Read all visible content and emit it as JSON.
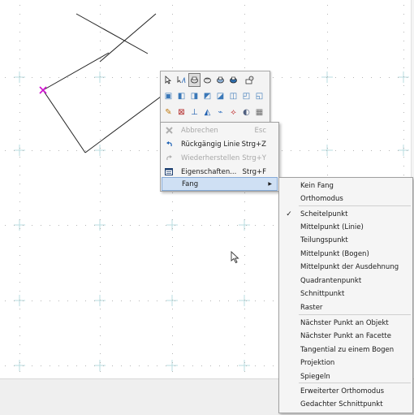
{
  "palette": {
    "row1": [
      {
        "icon": "pointer-icon",
        "active": false
      },
      {
        "icon": "node-pointer-icon",
        "active": false
      },
      {
        "icon": "snap-object-icon",
        "active": true
      },
      {
        "icon": "snap-object-2-icon",
        "active": false
      },
      {
        "icon": "snap-object-3-icon",
        "active": false
      },
      {
        "icon": "snap-object-4-icon",
        "active": false
      },
      {
        "icon": "snap-settings-icon",
        "active": false
      }
    ],
    "row2": [
      {
        "icon": "cube-view-1-icon"
      },
      {
        "icon": "cube-view-2-icon"
      },
      {
        "icon": "cube-view-3-icon"
      },
      {
        "icon": "cube-view-4-icon"
      },
      {
        "icon": "cube-view-5-icon"
      },
      {
        "icon": "cube-view-6-icon"
      },
      {
        "icon": "cube-view-7-icon"
      },
      {
        "icon": "cube-view-8-icon"
      }
    ],
    "row3": [
      {
        "icon": "tool-1-icon"
      },
      {
        "icon": "tool-2-icon"
      },
      {
        "icon": "tool-3-icon"
      },
      {
        "icon": "tool-4-icon"
      },
      {
        "icon": "tool-5-icon"
      },
      {
        "icon": "tool-6-icon"
      },
      {
        "icon": "tool-7-icon"
      },
      {
        "icon": "tool-8-icon"
      }
    ]
  },
  "menu": {
    "items": [
      {
        "label": "Abbrechen",
        "shortcut": "Esc",
        "icon": "cancel-icon",
        "disabled": true
      },
      {
        "label": "Rückgängig Linie",
        "shortcut": "Strg+Z",
        "icon": "undo-icon",
        "disabled": false
      },
      {
        "label": "Wiederherstellen",
        "shortcut": "Strg+Y",
        "icon": "redo-icon",
        "disabled": true
      },
      {
        "label": "Eigenschaften...",
        "shortcut": "Strg+F",
        "icon": "properties-icon",
        "disabled": false
      },
      {
        "label": "Fang",
        "shortcut": "",
        "icon": "",
        "disabled": false,
        "highlight": true,
        "submenu": true
      }
    ]
  },
  "submenu": {
    "items": [
      {
        "label": "Kein Fang",
        "checked": false
      },
      {
        "label": "Orthomodus",
        "checked": false
      },
      {
        "label": "Scheitelpunkt",
        "checked": true
      },
      {
        "label": "Mittelpunkt (Linie)",
        "checked": false
      },
      {
        "label": "Teilungspunkt",
        "checked": false
      },
      {
        "label": "Mittelpunkt (Bogen)",
        "checked": false
      },
      {
        "label": "Mittelpunkt der Ausdehnung",
        "checked": false
      },
      {
        "label": "Quadrantenpunkt",
        "checked": false
      },
      {
        "label": "Schnittpunkt",
        "checked": false
      },
      {
        "label": "Raster",
        "checked": false
      },
      {
        "label": "Nächster Punkt an Objekt",
        "checked": false
      },
      {
        "label": "Nächster Punkt an Facette",
        "checked": false
      },
      {
        "label": "Tangential zu einem Bogen",
        "checked": false
      },
      {
        "label": "Projektion",
        "checked": false
      },
      {
        "label": "Spiegeln",
        "checked": false
      },
      {
        "label": "Erweiterter Orthomodus",
        "checked": false
      },
      {
        "label": "Gedachter Schnittpunkt",
        "checked": false
      }
    ]
  },
  "colors": {
    "grid_cross": "#b9dde0",
    "grid_dot": "#b5b5b5",
    "vertex_marker": "#d010d0",
    "highlight": "#cfe0f4"
  }
}
